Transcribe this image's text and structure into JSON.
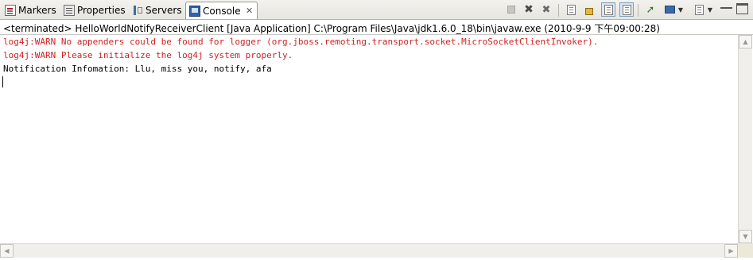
{
  "tabs": [
    {
      "label": "Markers",
      "icon": "markers-icon",
      "active": false
    },
    {
      "label": "Properties",
      "icon": "properties-icon",
      "active": false
    },
    {
      "label": "Servers",
      "icon": "servers-icon",
      "active": false
    },
    {
      "label": "Console",
      "icon": "console-icon",
      "active": true,
      "close": "✕"
    }
  ],
  "toolbar": {
    "icons": [
      "terminate-icon",
      "remove-launch-icon",
      "remove-all-terminated-icon",
      "clear-console-icon",
      "scroll-lock-icon",
      "show-on-stdout-icon",
      "show-on-stderr-icon",
      "pin-console-icon",
      "display-console-icon",
      "open-console-icon",
      "minimize-icon",
      "maximize-icon"
    ]
  },
  "process_label": "<terminated> HelloWorldNotifyReceiverClient [Java Application] C:\\Program Files\\Java\\jdk1.6.0_18\\bin\\javaw.exe (2010-9-9 下午09:00:28)",
  "console_lines": [
    {
      "text": "log4j:WARN No appenders could be found for logger (org.jboss.remoting.transport.socket.MicroSocketClientInvoker).",
      "type": "stderr"
    },
    {
      "text": "log4j:WARN Please initialize the log4j system properly.",
      "type": "stderr"
    },
    {
      "text": "Notification Infomation: Llu, miss you, notify, afa",
      "type": "stdout"
    }
  ],
  "colors": {
    "stderr": "#d21f1f",
    "stdout": "#000000",
    "tab_bar": "#e7e5df"
  }
}
